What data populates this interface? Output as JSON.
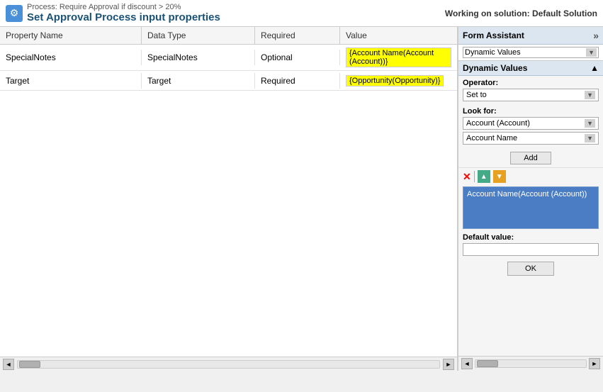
{
  "topbar": {
    "process_label": "Process: Require Approval if discount > 20%",
    "title": "Set Approval Process input properties",
    "working_on": "Working on solution: Default Solution"
  },
  "table": {
    "headers": [
      "Property Name",
      "Data Type",
      "Required",
      "Value"
    ],
    "rows": [
      {
        "property": "SpecialNotes",
        "dataType": "SpecialNotes",
        "required": "Optional",
        "value": "{Account Name(Account (Account))}"
      },
      {
        "property": "Target",
        "dataType": "Target",
        "required": "Required",
        "value": "{Opportunity(Opportunity)}"
      }
    ]
  },
  "formAssistant": {
    "title": "Form Assistant",
    "expand_icon": "»",
    "dynamic_values_select": "Dynamic Values",
    "dynamic_values_section": "Dynamic Values",
    "operator_label": "Operator:",
    "operator_value": "Set to",
    "look_for_label": "Look for:",
    "look_for_value": "Account (Account)",
    "account_name_value": "Account Name",
    "add_button": "Add",
    "selected_item": "Account Name(Account (Account))",
    "default_value_label": "Default value:",
    "default_value": "",
    "ok_button": "OK"
  },
  "scrollbar": {
    "left_arrow": "◄",
    "right_arrow": "►"
  }
}
